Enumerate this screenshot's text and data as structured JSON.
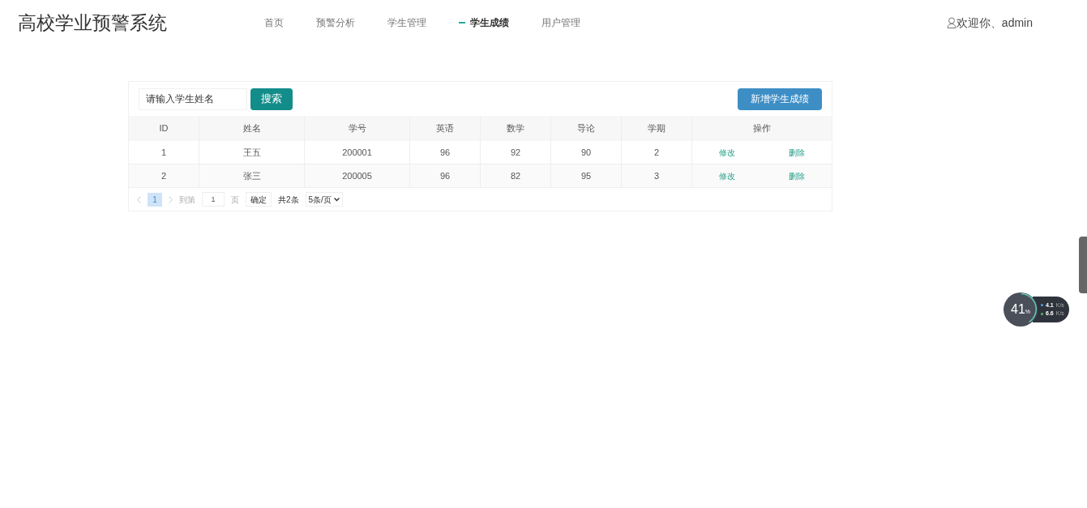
{
  "header": {
    "title": "高校学业预警系统",
    "nav": [
      {
        "label": "首页",
        "selected": false
      },
      {
        "label": "预警分析",
        "selected": false
      },
      {
        "label": "学生管理",
        "selected": false
      },
      {
        "label": "学生成绩",
        "selected": true
      },
      {
        "label": "用户管理",
        "selected": false
      }
    ],
    "user": "欢迎你、admin"
  },
  "toolbar": {
    "search": {
      "placeholder": "请输入学生姓名"
    },
    "search_button": "搜索",
    "add_button": "新增学生成绩"
  },
  "table": {
    "columns": [
      "ID",
      "姓名",
      "学号",
      "英语",
      "数学",
      "导论",
      "学期",
      "操作"
    ],
    "rows": [
      {
        "cells": [
          "1",
          "王五",
          "200001",
          "96",
          "92",
          "90",
          "2"
        ],
        "actions": [
          "修改",
          "删除"
        ]
      },
      {
        "cells": [
          "2",
          "张三",
          "200005",
          "96",
          "82",
          "95",
          "3"
        ],
        "actions": [
          "修改",
          "删除"
        ]
      }
    ]
  },
  "pagination": {
    "pages": [
      {
        "label": "1",
        "selected": true
      }
    ],
    "goto_label": "到第",
    "goto_value": "1",
    "page_unit": "页",
    "confirm": "确定",
    "total": "共2条",
    "page_size": "5条/页"
  },
  "speed_widget": {
    "percent": "41",
    "percent_sign": "%",
    "upload": "4.1",
    "upload_unit": "K/s",
    "download": "6.6",
    "download_unit": "K/s"
  }
}
